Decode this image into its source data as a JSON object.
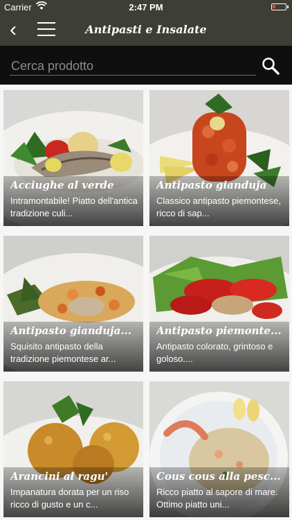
{
  "status": {
    "carrier": "Carrier",
    "time": "2:47 PM",
    "battery_color": "#ff3b30"
  },
  "nav": {
    "title": "Antipasti e Insalate",
    "bar_color": "#3d3e35"
  },
  "search": {
    "placeholder": "Cerca prodotto"
  },
  "products": [
    {
      "title": "Acciughe al verde",
      "desc": "Intramontabile! Piatto dell'antica tradizione culi..."
    },
    {
      "title": "Antipasto gianduja",
      "desc": "Classico antipasto piemontese, ricco di sap..."
    },
    {
      "title": "Antipasto gianduja...",
      "desc": "Squisito antipasto della tradizione piemontese ar..."
    },
    {
      "title": "Antipasto piemonte...",
      "desc": "Antipasto colorato, grintoso e goloso...."
    },
    {
      "title": "Arancini al ragu'",
      "desc": "Impanatura dorata per un riso ricco di gusto e un c..."
    },
    {
      "title": "Cous cous alla pesc...",
      "desc": "Ricco piatto al sapore di mare. Ottimo piatto uni..."
    }
  ]
}
